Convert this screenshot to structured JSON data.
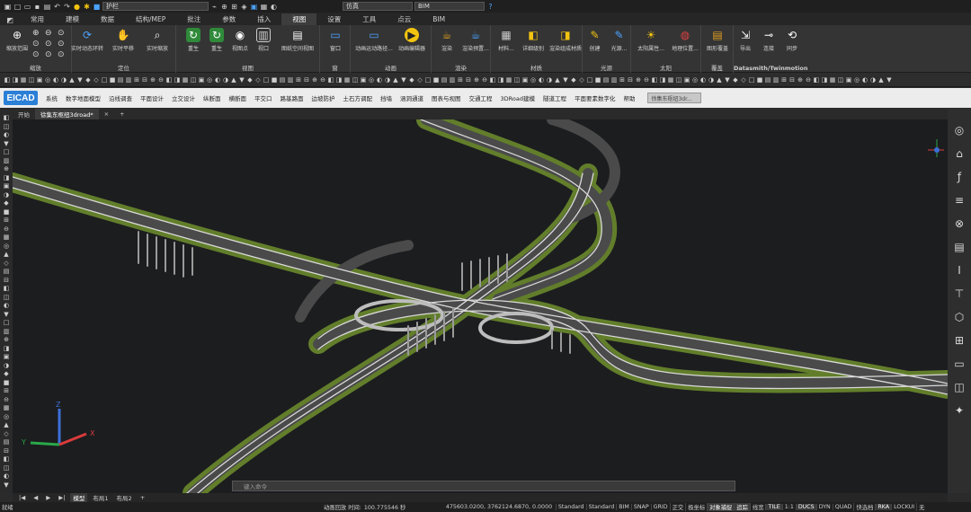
{
  "quick_access": {
    "workspace": "护栏",
    "visual_style": "仿真",
    "mode": "BIM"
  },
  "ribbon_tabs": [
    "常用",
    "建模",
    "数据",
    "结构/MEP",
    "批注",
    "参数",
    "插入",
    "视图",
    "设置",
    "工具",
    "点云",
    "BIM"
  ],
  "active_tab": "视图",
  "ribbon_groups": [
    {
      "label": "缩放",
      "buttons": [
        "缩放范围"
      ]
    },
    {
      "label": "定位",
      "buttons": [
        "实时动态环转",
        "实时平移",
        "实时缩放"
      ]
    },
    {
      "label": "视图",
      "buttons": [
        "重生",
        "重生",
        "视图点",
        "视口",
        "图纸空间视图"
      ]
    },
    {
      "label": "窗",
      "buttons": [
        "窗口"
      ]
    },
    {
      "label": "动画",
      "buttons": [
        "动画运动路径...",
        "动画编辑器"
      ]
    },
    {
      "label": "渲染",
      "buttons": [
        "渲染",
        "渲染预置..."
      ]
    },
    {
      "label": "材质",
      "buttons": [
        "材料...",
        "详细级别",
        "渲染组成材质"
      ]
    },
    {
      "label": "光源",
      "buttons": [
        "创建",
        "光源..."
      ]
    },
    {
      "label": "太阳",
      "buttons": [
        "太阳属性...",
        "地理位置..."
      ]
    },
    {
      "label": "覆盖",
      "buttons": [
        "图形覆盖"
      ]
    },
    {
      "label": "Datasmith/Twinmotion",
      "buttons": [
        "导出",
        "连接",
        "同步"
      ]
    }
  ],
  "eicad_menu": {
    "logo": "EICAD",
    "items": [
      "系统",
      "数字地面模型",
      "沿线调查",
      "平面设计",
      "立交设计",
      "纵断面",
      "横断面",
      "平交口",
      "路基路面",
      "边坡防护",
      "土石方调配",
      "挡墙",
      "涵洞通道",
      "图表与视图",
      "交通工程",
      "3DRoad建模",
      "隧道工程",
      "平面要素数字化",
      "帮助"
    ],
    "search": "徐集东枢纽3dr..."
  },
  "doc_tabs": [
    "开始",
    "徐集东枢纽3droad*"
  ],
  "ucs": {
    "x": "X",
    "y": "Y",
    "z": "Z"
  },
  "command_placeholder": "键入命令",
  "layout_tabs": [
    "模型",
    "布局1",
    "布局2"
  ],
  "status": {
    "left": "就绪",
    "anim_label": "动画回放 时间:",
    "anim_time": "100.775546 秒",
    "coords": "475603.0200, 3762124.6870, 0.0000",
    "buttons": [
      "Standard",
      "Standard",
      "BIM",
      "SNAP",
      "GRID",
      "正交",
      "极坐标",
      "对象捕捉",
      "追踪",
      "线宽",
      "TILE",
      "1:1",
      "DUCS",
      "DYN",
      "QUAD",
      "快选档",
      "RKA",
      "LOCKUI",
      "无"
    ]
  },
  "colors": {
    "accent": "#2b7fd6",
    "road_green": "#6f8f2e",
    "viewport_bg": "#1c1d1f"
  }
}
